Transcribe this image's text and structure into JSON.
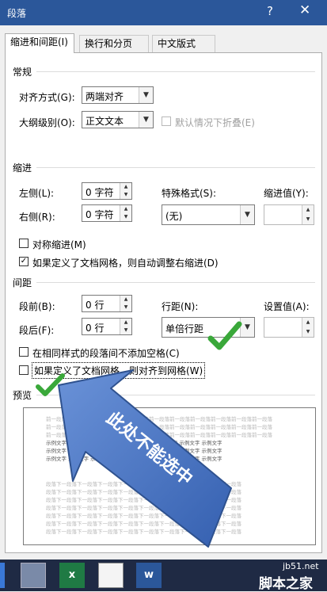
{
  "window": {
    "title": "段落",
    "help_glyph": "?",
    "close_glyph": "✕"
  },
  "tabs": [
    {
      "label": "缩进和间距(I)",
      "active": true
    },
    {
      "label": "换行和分页(P)",
      "active": false
    },
    {
      "label": "中文版式(H)",
      "active": false
    }
  ],
  "general": {
    "heading": "常规",
    "alignment_label": "对齐方式(G):",
    "alignment_value": "两端对齐",
    "outline_label": "大纲级别(O):",
    "outline_value": "正文文本",
    "collapse_label": "默认情况下折叠(E)",
    "collapse_checked": false
  },
  "indent": {
    "heading": "缩进",
    "left_label": "左侧(L):",
    "left_value": "0 字符",
    "right_label": "右侧(R):",
    "right_value": "0 字符",
    "special_label": "特殊格式(S):",
    "special_value": "(无)",
    "by_label": "缩进值(Y):",
    "by_value": "",
    "mirror_label": "对称缩进(M)",
    "mirror_checked": false,
    "autoadjust_label": "如果定义了文档网格，则自动调整右缩进(D)",
    "autoadjust_checked": true
  },
  "spacing": {
    "heading": "间距",
    "before_label": "段前(B):",
    "before_value": "0 行",
    "after_label": "段后(F):",
    "after_value": "0 行",
    "linespacing_label": "行距(N):",
    "linespacing_value": "单倍行距",
    "at_label": "设置值(A):",
    "at_value": "",
    "nospace_label": "在相同样式的段落间不添加空格(C)",
    "nospace_checked": false,
    "snapgrid_label": "如果定义了文档网格，则对齐到网格(W)",
    "snapgrid_checked": false
  },
  "preview": {
    "heading": "预览",
    "prev_line": "前一段落前一段落前一段落前一段落前一段落前一段落前一段落前一段落前一段落前一段落前一段落",
    "sample_line": "示例文字 示例文字 示例文字 示例文字 示例文字 示例文字 示例文字 示例文字",
    "next_line": "段落下一段落下一段落下一段落下一段落下一段落下一段落下一段落下一段落下一段落"
  },
  "annotation": {
    "callout_text": "此处不能选中",
    "arrow_color": "#4472c4",
    "check_color": "#3aa83a"
  },
  "watermark": {
    "site": "jb51.net",
    "name": "脚本之家"
  },
  "colors": {
    "titlebar": "#2b579a",
    "taskbar": "#1f2a44"
  }
}
